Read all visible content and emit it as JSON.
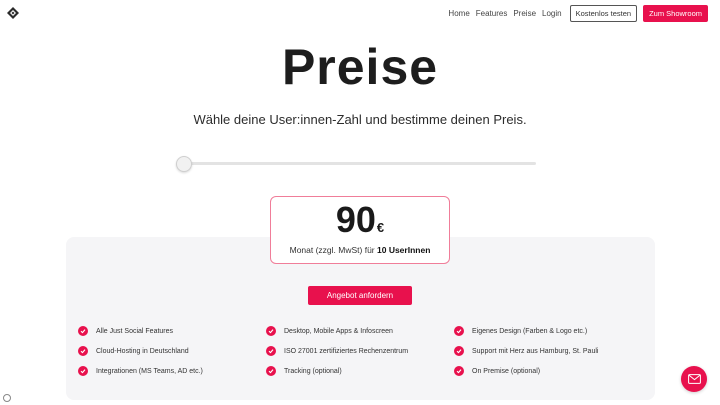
{
  "nav": {
    "links": [
      "Home",
      "Features",
      "Preise",
      "Login"
    ],
    "trial_label": "Kostenlos testen",
    "showroom_label": "Zum Showroom"
  },
  "hero": {
    "title": "Preise",
    "subtitle": "Wähle deine User:innen-Zahl und bestimme deinen Preis."
  },
  "slider": {
    "value": 10
  },
  "price": {
    "amount": "90",
    "currency": "€",
    "desc_prefix": "Monat (zzgl. MwSt) für ",
    "users": "10 UserInnen"
  },
  "cta": {
    "label": "Angebot anfordern"
  },
  "features": [
    "Alle Just Social Features",
    "Desktop, Mobile Apps & Infoscreen",
    "Eigenes Design (Farben & Logo etc.)",
    "Cloud-Hosting in Deutschland",
    "ISO 27001 zertifiziertes Rechenzentrum",
    "Support mit Herz aus Hamburg, St. Pauli",
    "Integrationen (MS Teams, AD etc.)",
    "Tracking (optional)",
    "On Premise (optional)"
  ],
  "icons": {
    "logo": "logo-icon",
    "check": "check-icon",
    "chat": "mail-icon"
  },
  "colors": {
    "accent": "#e8114d",
    "price_border": "#f07d99",
    "panel": "#f5f5f7"
  }
}
